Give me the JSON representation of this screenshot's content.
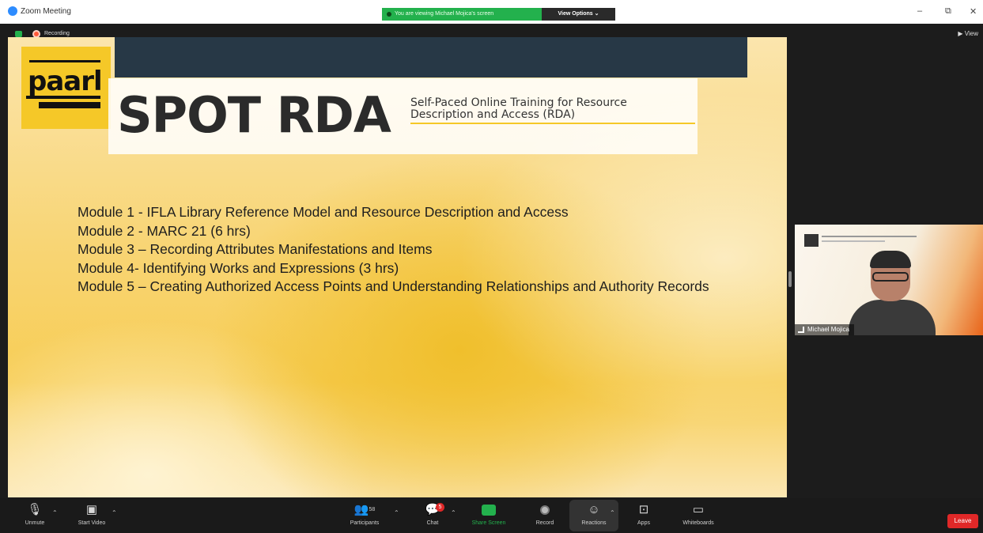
{
  "window": {
    "title": "Zoom Meeting",
    "banner": "You are viewing Michael Mojica's screen",
    "view_options": "View Options ⌄",
    "minimize": "–",
    "restore": "⧉",
    "close": "✕"
  },
  "meeting": {
    "recording_label": "Recording",
    "view_label": "View"
  },
  "slide": {
    "logo_text": "paarl",
    "title": "SPOT RDA",
    "subtitle": "Self-Paced Online Training for Resource Description and Access (RDA)",
    "modules": [
      "Module 1 - IFLA Library Reference Model and Resource Description and Access",
      "Module 2 - MARC 21 (6 hrs)",
      "Module 3 – Recording Attributes Manifestations and Items",
      "Module 4- Identifying Works and Expressions (3 hrs)",
      "Module 5 – Creating Authorized Access Points and Understanding Relationships and Authority Records"
    ]
  },
  "participant_tile": {
    "name": "Michael Mojica"
  },
  "toolbar": {
    "unmute": "Unmute",
    "start_video": "Start Video",
    "participants": "Participants",
    "participants_count": "58",
    "chat": "Chat",
    "chat_badge": "5",
    "share_screen": "Share Screen",
    "record": "Record",
    "reactions": "Reactions",
    "apps": "Apps",
    "whiteboards": "Whiteboards",
    "leave": "Leave"
  },
  "icons": {
    "mic_muted": "mic-muted-icon",
    "video_off": "video-off-icon",
    "participants": "participants-icon",
    "chat": "chat-icon",
    "share": "share-screen-icon",
    "record": "record-icon",
    "reactions": "reactions-icon",
    "apps": "apps-icon",
    "whiteboards": "whiteboard-icon"
  },
  "colors": {
    "accent_green": "#23b14d",
    "leave_red": "#e02828",
    "slide_yellow": "#f5c828",
    "slide_navy": "#273846"
  }
}
